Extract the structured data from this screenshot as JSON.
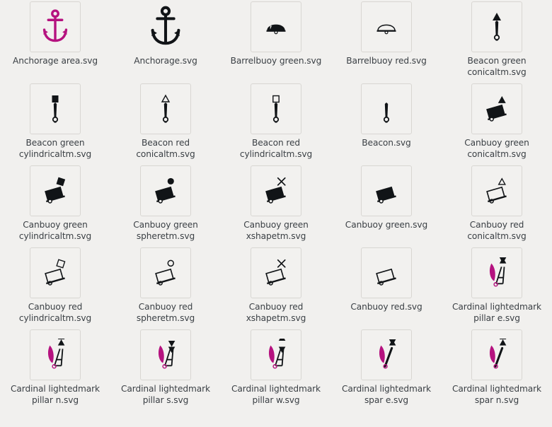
{
  "view": {
    "type": "icon-grid-file-browser",
    "columns": 5,
    "rows": 5,
    "background_color": "#f1f0ee",
    "label_color": "#3b4045",
    "tile_border_color": "#d8d6d2",
    "tile_background_color": "#f2f1ef",
    "accent_color": "#b5127f",
    "ink_color": "#111417"
  },
  "files": [
    {
      "name": "Anchorage area.svg",
      "icon": "anchor-magenta",
      "selected": true
    },
    {
      "name": "Anchorage.svg",
      "icon": "anchor-black",
      "selected": false
    },
    {
      "name": "Barrelbuoy green.svg",
      "icon": "barrelbuoy-filled",
      "selected": false
    },
    {
      "name": "Barrelbuoy red.svg",
      "icon": "barrelbuoy-outline",
      "selected": false
    },
    {
      "name": "Beacon green conicaltm.svg",
      "icon": "beacon-conical-filled",
      "selected": false
    },
    {
      "name": "Beacon green cylindricaltm.svg",
      "icon": "beacon-cylindrical-filled",
      "selected": false
    },
    {
      "name": "Beacon red conicaltm.svg",
      "icon": "beacon-conical-outline",
      "selected": false
    },
    {
      "name": "Beacon red cylindricaltm.svg",
      "icon": "beacon-cylindrical-outline",
      "selected": false
    },
    {
      "name": "Beacon.svg",
      "icon": "beacon-plain",
      "selected": false
    },
    {
      "name": "Canbuoy green conicaltm.svg",
      "icon": "canbuoy-conical-filled",
      "selected": false
    },
    {
      "name": "Canbuoy green cylindricaltm.svg",
      "icon": "canbuoy-cylindrical-filled",
      "selected": false
    },
    {
      "name": "Canbuoy green spheretm.svg",
      "icon": "canbuoy-sphere-filled",
      "selected": false
    },
    {
      "name": "Canbuoy green xshapetm.svg",
      "icon": "canbuoy-xshape-filled",
      "selected": false
    },
    {
      "name": "Canbuoy green.svg",
      "icon": "canbuoy-plain-filled",
      "selected": false
    },
    {
      "name": "Canbuoy red conicaltm.svg",
      "icon": "canbuoy-conical-outline",
      "selected": false
    },
    {
      "name": "Canbuoy red cylindricaltm.svg",
      "icon": "canbuoy-cylindrical-outline",
      "selected": false
    },
    {
      "name": "Canbuoy red spheretm.svg",
      "icon": "canbuoy-sphere-outline",
      "selected": false
    },
    {
      "name": "Canbuoy red xshapetm.svg",
      "icon": "canbuoy-xshape-outline",
      "selected": false
    },
    {
      "name": "Canbuoy red.svg",
      "icon": "canbuoy-plain-outline",
      "selected": false
    },
    {
      "name": "Cardinal lightedmark pillar e.svg",
      "icon": "cardinal-pillar-e",
      "selected": false
    },
    {
      "name": "Cardinal lightedmark pillar n.svg",
      "icon": "cardinal-pillar-n",
      "selected": false
    },
    {
      "name": "Cardinal lightedmark pillar s.svg",
      "icon": "cardinal-pillar-s",
      "selected": false
    },
    {
      "name": "Cardinal lightedmark pillar w.svg",
      "icon": "cardinal-pillar-w",
      "selected": false
    },
    {
      "name": "Cardinal lightedmark spar e.svg",
      "icon": "cardinal-spar-e",
      "selected": false
    },
    {
      "name": "Cardinal lightedmark spar n.svg",
      "icon": "cardinal-spar-n",
      "selected": false
    }
  ]
}
